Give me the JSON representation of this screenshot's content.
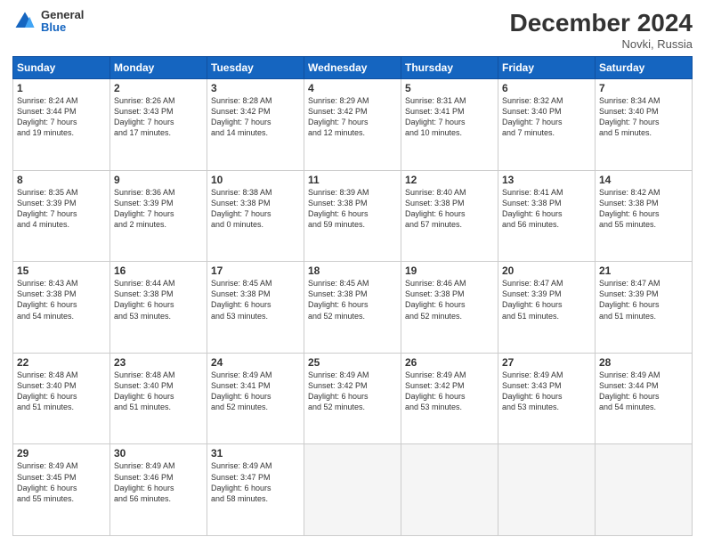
{
  "header": {
    "logo_general": "General",
    "logo_blue": "Blue",
    "title": "December 2024",
    "location": "Novki, Russia"
  },
  "weekdays": [
    "Sunday",
    "Monday",
    "Tuesday",
    "Wednesday",
    "Thursday",
    "Friday",
    "Saturday"
  ],
  "weeks": [
    [
      {
        "day": "1",
        "info": "Sunrise: 8:24 AM\nSunset: 3:44 PM\nDaylight: 7 hours\nand 19 minutes."
      },
      {
        "day": "2",
        "info": "Sunrise: 8:26 AM\nSunset: 3:43 PM\nDaylight: 7 hours\nand 17 minutes."
      },
      {
        "day": "3",
        "info": "Sunrise: 8:28 AM\nSunset: 3:42 PM\nDaylight: 7 hours\nand 14 minutes."
      },
      {
        "day": "4",
        "info": "Sunrise: 8:29 AM\nSunset: 3:42 PM\nDaylight: 7 hours\nand 12 minutes."
      },
      {
        "day": "5",
        "info": "Sunrise: 8:31 AM\nSunset: 3:41 PM\nDaylight: 7 hours\nand 10 minutes."
      },
      {
        "day": "6",
        "info": "Sunrise: 8:32 AM\nSunset: 3:40 PM\nDaylight: 7 hours\nand 7 minutes."
      },
      {
        "day": "7",
        "info": "Sunrise: 8:34 AM\nSunset: 3:40 PM\nDaylight: 7 hours\nand 5 minutes."
      }
    ],
    [
      {
        "day": "8",
        "info": "Sunrise: 8:35 AM\nSunset: 3:39 PM\nDaylight: 7 hours\nand 4 minutes."
      },
      {
        "day": "9",
        "info": "Sunrise: 8:36 AM\nSunset: 3:39 PM\nDaylight: 7 hours\nand 2 minutes."
      },
      {
        "day": "10",
        "info": "Sunrise: 8:38 AM\nSunset: 3:38 PM\nDaylight: 7 hours\nand 0 minutes."
      },
      {
        "day": "11",
        "info": "Sunrise: 8:39 AM\nSunset: 3:38 PM\nDaylight: 6 hours\nand 59 minutes."
      },
      {
        "day": "12",
        "info": "Sunrise: 8:40 AM\nSunset: 3:38 PM\nDaylight: 6 hours\nand 57 minutes."
      },
      {
        "day": "13",
        "info": "Sunrise: 8:41 AM\nSunset: 3:38 PM\nDaylight: 6 hours\nand 56 minutes."
      },
      {
        "day": "14",
        "info": "Sunrise: 8:42 AM\nSunset: 3:38 PM\nDaylight: 6 hours\nand 55 minutes."
      }
    ],
    [
      {
        "day": "15",
        "info": "Sunrise: 8:43 AM\nSunset: 3:38 PM\nDaylight: 6 hours\nand 54 minutes."
      },
      {
        "day": "16",
        "info": "Sunrise: 8:44 AM\nSunset: 3:38 PM\nDaylight: 6 hours\nand 53 minutes."
      },
      {
        "day": "17",
        "info": "Sunrise: 8:45 AM\nSunset: 3:38 PM\nDaylight: 6 hours\nand 53 minutes."
      },
      {
        "day": "18",
        "info": "Sunrise: 8:45 AM\nSunset: 3:38 PM\nDaylight: 6 hours\nand 52 minutes."
      },
      {
        "day": "19",
        "info": "Sunrise: 8:46 AM\nSunset: 3:38 PM\nDaylight: 6 hours\nand 52 minutes."
      },
      {
        "day": "20",
        "info": "Sunrise: 8:47 AM\nSunset: 3:39 PM\nDaylight: 6 hours\nand 51 minutes."
      },
      {
        "day": "21",
        "info": "Sunrise: 8:47 AM\nSunset: 3:39 PM\nDaylight: 6 hours\nand 51 minutes."
      }
    ],
    [
      {
        "day": "22",
        "info": "Sunrise: 8:48 AM\nSunset: 3:40 PM\nDaylight: 6 hours\nand 51 minutes."
      },
      {
        "day": "23",
        "info": "Sunrise: 8:48 AM\nSunset: 3:40 PM\nDaylight: 6 hours\nand 51 minutes."
      },
      {
        "day": "24",
        "info": "Sunrise: 8:49 AM\nSunset: 3:41 PM\nDaylight: 6 hours\nand 52 minutes."
      },
      {
        "day": "25",
        "info": "Sunrise: 8:49 AM\nSunset: 3:42 PM\nDaylight: 6 hours\nand 52 minutes."
      },
      {
        "day": "26",
        "info": "Sunrise: 8:49 AM\nSunset: 3:42 PM\nDaylight: 6 hours\nand 53 minutes."
      },
      {
        "day": "27",
        "info": "Sunrise: 8:49 AM\nSunset: 3:43 PM\nDaylight: 6 hours\nand 53 minutes."
      },
      {
        "day": "28",
        "info": "Sunrise: 8:49 AM\nSunset: 3:44 PM\nDaylight: 6 hours\nand 54 minutes."
      }
    ],
    [
      {
        "day": "29",
        "info": "Sunrise: 8:49 AM\nSunset: 3:45 PM\nDaylight: 6 hours\nand 55 minutes."
      },
      {
        "day": "30",
        "info": "Sunrise: 8:49 AM\nSunset: 3:46 PM\nDaylight: 6 hours\nand 56 minutes."
      },
      {
        "day": "31",
        "info": "Sunrise: 8:49 AM\nSunset: 3:47 PM\nDaylight: 6 hours\nand 58 minutes."
      },
      {
        "day": "",
        "info": ""
      },
      {
        "day": "",
        "info": ""
      },
      {
        "day": "",
        "info": ""
      },
      {
        "day": "",
        "info": ""
      }
    ]
  ]
}
